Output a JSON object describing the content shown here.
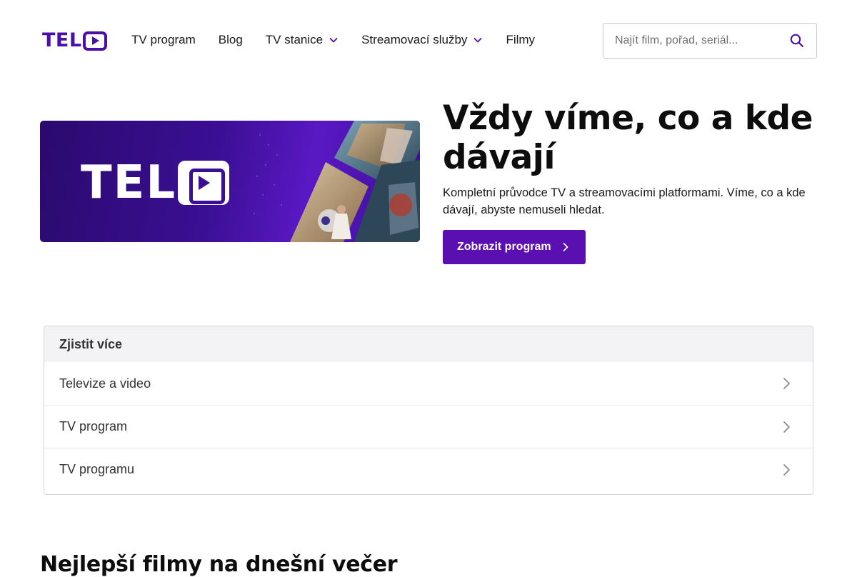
{
  "header": {
    "logo_label": "TELO",
    "nav": [
      {
        "label": "TV program",
        "has_dropdown": false
      },
      {
        "label": "Blog",
        "has_dropdown": false
      },
      {
        "label": "TV stanice",
        "has_dropdown": true
      },
      {
        "label": "Streamovací služby",
        "has_dropdown": true
      },
      {
        "label": "Filmy",
        "has_dropdown": false
      }
    ],
    "search": {
      "placeholder": "Najít film, pořad, seriál...",
      "value": ""
    }
  },
  "hero": {
    "banner_wordmark": "TELO",
    "title": "Vždy víme, co a kde dávají",
    "subtitle": "Kompletní průvodce TV a streamovacími platformami. Víme, co a kde dávají, abyste nemuseli hledat.",
    "cta_label": "Zobrazit program"
  },
  "more": {
    "heading": "Zjistit více",
    "items": [
      {
        "label": "Televize a video"
      },
      {
        "label": "TV program"
      },
      {
        "label": "TV programu"
      }
    ]
  },
  "sections": {
    "best_movies_title": "Nejlepší filmy na dnešní večer"
  },
  "colors": {
    "brand": "#4b0fa8",
    "cta": "#5a0fb0",
    "banner_dark": "#2a0a6e"
  }
}
